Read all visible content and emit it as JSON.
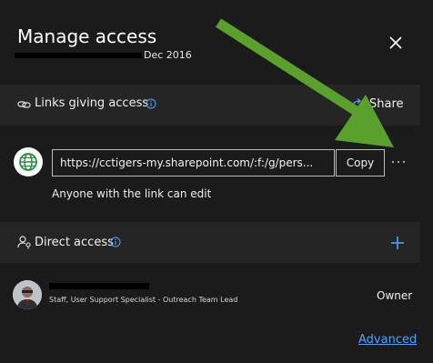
{
  "panel": {
    "title": "Manage access",
    "subtitle_date": "Dec 2016",
    "close_icon": "close-icon"
  },
  "links_section": {
    "label": "Links giving access",
    "share_label": "Share",
    "icons": [
      "link-icon",
      "info-icon",
      "share-icon"
    ]
  },
  "link_item": {
    "url": "https://cctigers-my.sharepoint.com/:f:/g/pers...",
    "copy_label": "Copy",
    "more_label": "···",
    "description": "Anyone with the link can edit",
    "icon": "globe-icon"
  },
  "direct_section": {
    "label": "Direct access",
    "add_label": "+",
    "icons": [
      "person-key-icon",
      "info-icon",
      "add-icon"
    ]
  },
  "user": {
    "role": "Staff, User Support Specialist - Outreach Team Lead",
    "permission": "Owner"
  },
  "footer": {
    "advanced_label": "Advanced"
  },
  "colors": {
    "background": "#1b1b1b",
    "section_background": "#252525",
    "accent": "#4ea1ff",
    "globe": "#2e8b3d",
    "annotation_arrow": "#5aa02c"
  }
}
